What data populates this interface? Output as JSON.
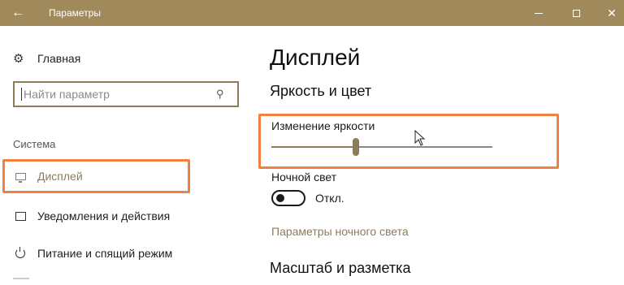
{
  "window": {
    "title": "Параметры",
    "back_icon": "arrow-left-icon",
    "minimize_icon": "minimize-icon",
    "maximize_icon": "maximize-icon",
    "close_icon": "close-icon",
    "titlebar_color": "#a08a5c"
  },
  "sidebar": {
    "home_label": "Главная",
    "home_icon": "gear-icon",
    "search": {
      "placeholder": "Найти параметр",
      "icon": "search-icon"
    },
    "section": "Система",
    "items": [
      {
        "label": "Дисплей",
        "icon": "monitor-icon",
        "selected": true
      },
      {
        "label": "Уведомления и действия",
        "icon": "message-icon",
        "selected": false
      },
      {
        "label": "Питание и спящий режим",
        "icon": "power-icon",
        "selected": false
      }
    ]
  },
  "main": {
    "title": "Дисплей",
    "brightness_section": "Яркость и цвет",
    "brightness_label": "Изменение яркости",
    "brightness_level_fraction": 0.38,
    "night_light_label": "Ночной свет",
    "night_light_state": "Откл.",
    "night_light_on": false,
    "night_light_link": "Параметры ночного света",
    "scale_section": "Масштаб и разметка"
  },
  "accent_color": "#8c7c5a",
  "highlight_color": "#f08040"
}
